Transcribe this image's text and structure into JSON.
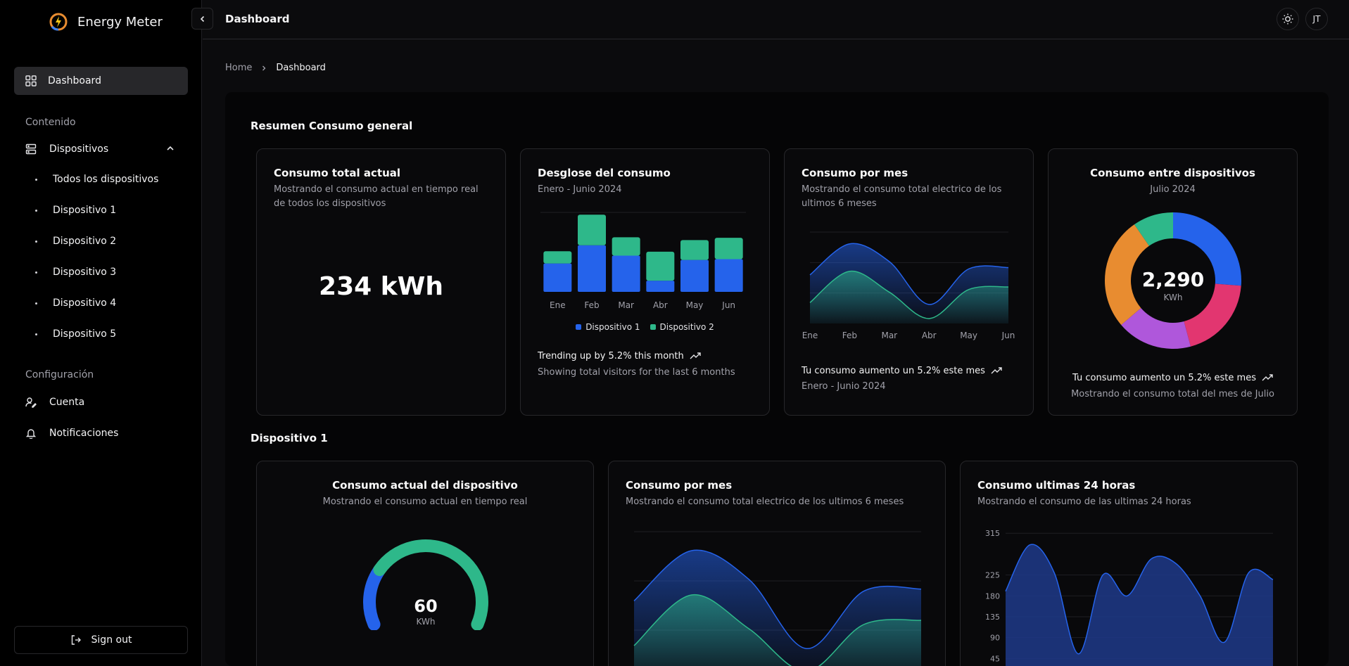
{
  "app": {
    "name": "Energy Meter",
    "page_title": "Dashboard"
  },
  "header": {
    "avatar_initials": "JT"
  },
  "sidebar": {
    "active_item": "Dashboard",
    "contenido_label": "Contenido",
    "dispositivos_label": "Dispositivos",
    "devices": [
      "Todos los dispositivos",
      "Dispositivo 1",
      "Dispositivo 2",
      "Dispositivo 3",
      "Dispositivo 4",
      "Dispositivo 5"
    ],
    "config_label": "Configuración",
    "cuenta_label": "Cuenta",
    "notificaciones_label": "Notificaciones",
    "signout_label": "Sign out"
  },
  "breadcrumb": {
    "home": "Home",
    "current": "Dashboard"
  },
  "colors": {
    "blue": "#2563eb",
    "green": "#2eb88a",
    "orange": "#e88c30",
    "purple": "#af57db",
    "pink": "#e23670"
  },
  "summary": {
    "title": "Resumen Consumo general",
    "total_card": {
      "title": "Consumo total actual",
      "subtitle": "Mostrando el consumo actual en tiempo real de todos los dispositivos",
      "value": "234 kWh"
    },
    "breakdown_card": {
      "title": "Desglose del consumo",
      "subtitle": "Enero - Junio 2024",
      "trend": "Trending up by 5.2% this month",
      "footer": "Showing total visitors for the last 6 months"
    },
    "monthly_card": {
      "title": "Consumo por mes",
      "subtitle": "Mostrando el consumo total electrico de los ultimos 6 meses",
      "trend": "Tu consumo aumento un 5.2% este mes",
      "footer": "Enero - Junio 2024"
    },
    "devices_card": {
      "title": "Consumo entre dispositivos",
      "subtitle": "Julio 2024",
      "value": "2,290",
      "unit": "KWh",
      "trend": "Tu consumo aumento un 5.2% este mes",
      "footer": "Mostrando el consumo total del mes de Julio"
    }
  },
  "device1": {
    "title": "Dispositivo 1",
    "gauge_card": {
      "title": "Consumo actual del dispositivo",
      "subtitle": "Mostrando el consumo actual en tiempo real",
      "value": "60",
      "unit": "KWh"
    },
    "monthly_card": {
      "title": "Consumo por mes",
      "subtitle": "Mostrando el consumo total electrico de los ultimos 6 meses"
    },
    "hours_card": {
      "title": "Consumo ultimas 24 horas",
      "subtitle": "Mostrando el consumo de las ultimas 24 horas"
    }
  },
  "chart_data": [
    {
      "id": "breakdown",
      "type": "bar",
      "stacked": true,
      "categories": [
        "Ene",
        "Feb",
        "Mar",
        "Abr",
        "May",
        "Jun"
      ],
      "series": [
        {
          "name": "Dispositivo 1",
          "values": [
            186,
            305,
            237,
            73,
            209,
            214
          ]
        },
        {
          "name": "Dispositivo 2",
          "values": [
            80,
            200,
            120,
            190,
            130,
            140
          ]
        }
      ],
      "ylim": [
        0,
        520
      ],
      "legend": "bottom"
    },
    {
      "id": "monthly",
      "type": "area",
      "categories": [
        "Ene",
        "Feb",
        "Mar",
        "Abr",
        "May",
        "Jun"
      ],
      "series": [
        {
          "values": [
            186,
            305,
            237,
            73,
            209,
            214
          ]
        },
        {
          "values": [
            80,
            200,
            120,
            19,
            130,
            140
          ]
        }
      ],
      "ylim": [
        0,
        350
      ]
    },
    {
      "id": "devices_pie",
      "type": "pie",
      "donut": true,
      "slices": [
        {
          "value": 600,
          "color": "#2563eb"
        },
        {
          "value": 450,
          "color": "#e23670"
        },
        {
          "value": 410,
          "color": "#af57db"
        },
        {
          "value": 610,
          "color": "#e88c30"
        },
        {
          "value": 220,
          "color": "#2eb88a"
        }
      ]
    },
    {
      "id": "gauge",
      "type": "pie",
      "slices": [
        {
          "value": 25,
          "color": "#2563eb"
        },
        {
          "value": 75,
          "color": "#2eb88a"
        }
      ]
    },
    {
      "id": "device_monthly",
      "type": "area",
      "categories": [
        "Ene",
        "Feb",
        "Mar",
        "Abr",
        "May",
        "Jun"
      ],
      "series": [
        {
          "values": [
            186,
            305,
            237,
            73,
            209,
            214
          ]
        },
        {
          "values": [
            80,
            200,
            120,
            19,
            130,
            140
          ]
        }
      ],
      "ylim": [
        0,
        350
      ]
    },
    {
      "id": "hours",
      "type": "area",
      "yticks": [
        45,
        90,
        135,
        180,
        225,
        315
      ],
      "values": [
        190,
        290,
        230,
        55,
        225,
        180,
        260,
        250,
        180,
        80,
        230,
        215
      ],
      "ylim": [
        45,
        315
      ]
    }
  ]
}
